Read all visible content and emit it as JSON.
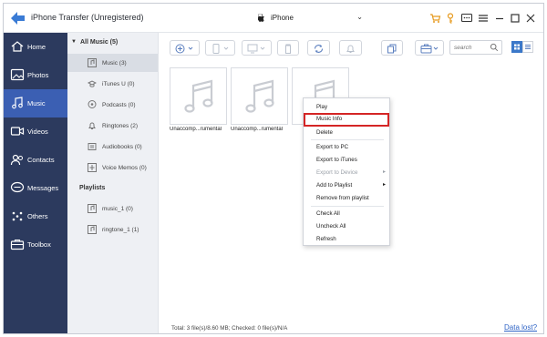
{
  "app": {
    "title": "iPhone Transfer (Unregistered)"
  },
  "device": {
    "name": "iPhone"
  },
  "sidebar": {
    "items": [
      {
        "label": "Home"
      },
      {
        "label": "Photos"
      },
      {
        "label": "Music"
      },
      {
        "label": "Videos"
      },
      {
        "label": "Contacts"
      },
      {
        "label": "Messages"
      },
      {
        "label": "Others"
      },
      {
        "label": "Toolbox"
      }
    ]
  },
  "categories": {
    "all_music": "All Music (5)",
    "items": [
      {
        "label": "Music (3)"
      },
      {
        "label": "iTunes U (0)"
      },
      {
        "label": "Podcasts (0)"
      },
      {
        "label": "Ringtones (2)"
      },
      {
        "label": "Audiobooks (0)"
      },
      {
        "label": "Voice Memos (0)"
      }
    ],
    "playlists_header": "Playlists",
    "playlists": [
      {
        "label": "music_1 (0)"
      },
      {
        "label": "ringtone_1 (1)"
      }
    ]
  },
  "search": {
    "placeholder": "search"
  },
  "files": [
    {
      "name": "Unaccomp...rumental"
    },
    {
      "name": "Unaccomp...rumental"
    }
  ],
  "context_menu": {
    "items": [
      {
        "label": "Play"
      },
      {
        "label": "Music Info"
      },
      {
        "label": "Delete"
      },
      {
        "label": "Export to PC"
      },
      {
        "label": "Export to iTunes"
      },
      {
        "label": "Export to Device"
      },
      {
        "label": "Add to Playlist"
      },
      {
        "label": "Remove from playlist"
      },
      {
        "label": "Check All"
      },
      {
        "label": "Uncheck All"
      },
      {
        "label": "Refresh"
      }
    ]
  },
  "footer": {
    "status": "Total: 3 file(s)/8.60 MB; Checked: 0 file(s)/N/A",
    "data_lost_link": "Data lost?"
  },
  "colors": {
    "sidebar_bg": "#2c3a5e",
    "sidebar_active": "#3b5fb3",
    "accent_orange": "#e69a1f",
    "highlight_red": "#d42525",
    "link_blue": "#2f64c6"
  }
}
